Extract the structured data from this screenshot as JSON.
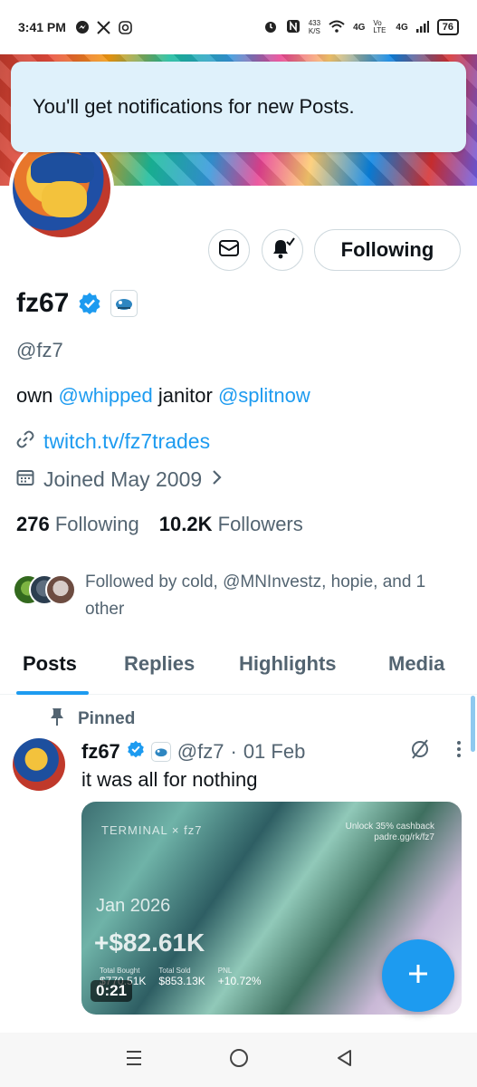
{
  "status_bar": {
    "time": "3:41 PM",
    "net_speed_value": "433",
    "net_speed_unit": "K/S",
    "network_4g_1": "4G",
    "network_volte": "Vo LTE",
    "network_4g_2": "4G",
    "battery": "76"
  },
  "toast": {
    "text": "You'll get notifications for new Posts."
  },
  "profile": {
    "name": "fz67",
    "handle": "@fz7",
    "bio_prefix": "own ",
    "bio_mention_1": "@whipped",
    "bio_middle": " janitor ",
    "bio_mention_2": "@splitnow",
    "website": "twitch.tv/fz7trades",
    "joined": "Joined May 2009",
    "following_count": "276",
    "following_label": "Following",
    "followers_count": "10.2K",
    "followers_label": "Followers",
    "followed_by": "Followed by cold, @MNInvestz, hopie, and 1 other"
  },
  "actions": {
    "follow_label": "Following"
  },
  "tabs": [
    {
      "label": "Posts",
      "active": true
    },
    {
      "label": "Replies",
      "active": false
    },
    {
      "label": "Highlights",
      "active": false
    },
    {
      "label": "Media",
      "active": false
    }
  ],
  "post": {
    "pinned_label": "Pinned",
    "author": "fz67",
    "handle": "@fz7",
    "separator": "·",
    "date": "01 Feb",
    "text": "it was all for nothing",
    "media": {
      "brand_left": "TERMINAL",
      "brand_x": "×",
      "brand_right": "fz7",
      "promo_line1": "Unlock 35% cashback",
      "promo_line2": "padre.gg/rk/fz7",
      "period": "Jan 2026",
      "pnl_value": "+$82.61K",
      "total_bought_label": "Total Bought",
      "total_bought_value": "$770.51K",
      "total_sold_label": "Total Sold",
      "total_sold_value": "$853.13K",
      "pnl_label": "PNL",
      "pnl_percent": "+10.72%",
      "duration": "0:21"
    }
  },
  "colors": {
    "accent": "#1d9bf0",
    "text": "#0f1419",
    "muted": "#536471",
    "toast_bg": "#dff1fb"
  },
  "icons": [
    "messenger-icon",
    "x-logo-icon",
    "instagram-icon",
    "alarm-icon",
    "nfc-icon",
    "wifi-icon",
    "signal-icon",
    "mail-icon",
    "bell-check-icon",
    "verified-icon",
    "link-icon",
    "calendar-icon",
    "chevron-right-icon",
    "pin-icon",
    "mute-icon",
    "more-icon",
    "plus-icon",
    "menu-icon",
    "home-icon",
    "back-icon"
  ]
}
